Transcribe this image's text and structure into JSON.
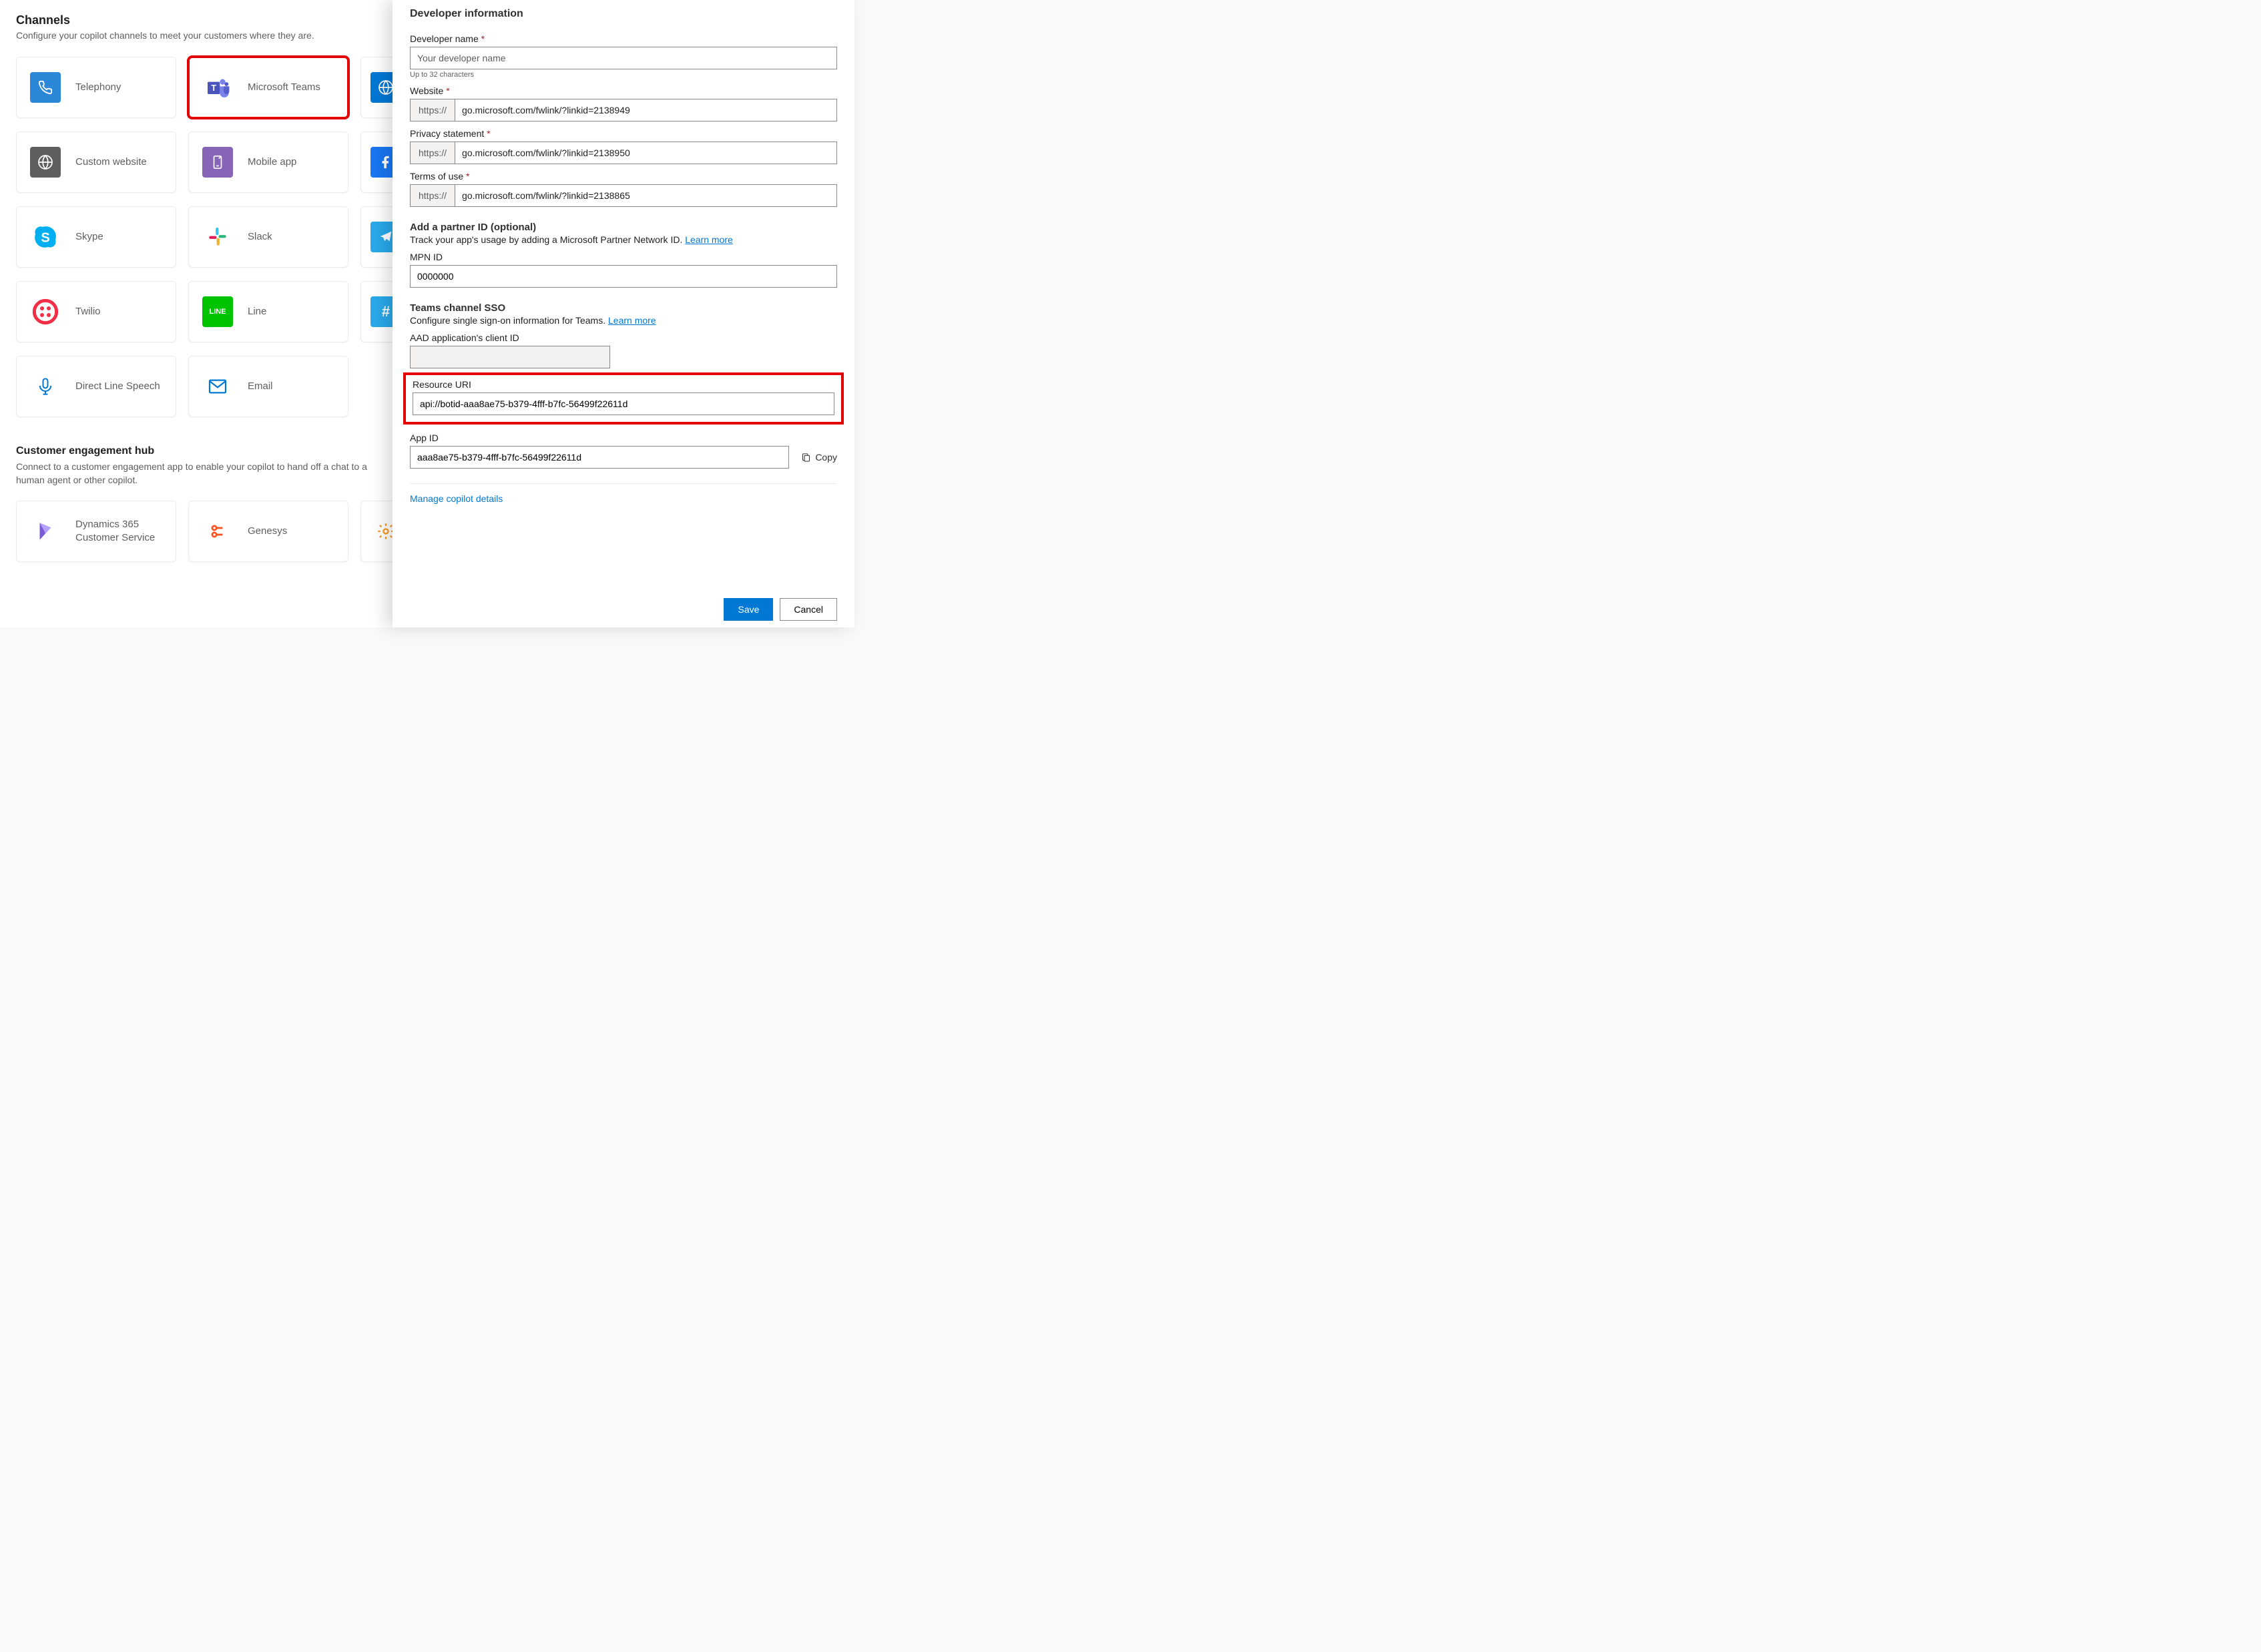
{
  "channels": {
    "title": "Channels",
    "subtitle": "Configure your copilot channels to meet your customers where they are.",
    "items": [
      {
        "id": "telephony",
        "label": "Telephony"
      },
      {
        "id": "teams",
        "label": "Microsoft Teams"
      },
      {
        "id": "demo-web",
        "label": ""
      },
      {
        "id": "custom-web",
        "label": "Custom website"
      },
      {
        "id": "mobile",
        "label": "Mobile app"
      },
      {
        "id": "facebook",
        "label": ""
      },
      {
        "id": "skype",
        "label": "Skype"
      },
      {
        "id": "slack",
        "label": "Slack"
      },
      {
        "id": "telegram",
        "label": ""
      },
      {
        "id": "twilio",
        "label": "Twilio"
      },
      {
        "id": "line",
        "label": "Line"
      },
      {
        "id": "groupme",
        "label": ""
      },
      {
        "id": "dls",
        "label": "Direct Line Speech"
      },
      {
        "id": "email",
        "label": "Email"
      }
    ]
  },
  "hub": {
    "title": "Customer engagement hub",
    "subtitle": "Connect to a customer engagement app to enable your copilot to hand off a chat to a human agent or other copilot.",
    "items": [
      {
        "id": "d365",
        "label": "Dynamics 365 Customer Service"
      },
      {
        "id": "genesys",
        "label": "Genesys"
      },
      {
        "id": "salesforce",
        "label": ""
      }
    ]
  },
  "panel": {
    "dev_info_heading": "Developer information",
    "dev_name_label": "Developer name",
    "dev_name_placeholder": "Your developer name",
    "dev_name_hint": "Up to 32 characters",
    "website_label": "Website",
    "https_prefix": "https://",
    "website_value": "go.microsoft.com/fwlink/?linkid=2138949",
    "privacy_label": "Privacy statement",
    "privacy_value": "go.microsoft.com/fwlink/?linkid=2138950",
    "terms_label": "Terms of use",
    "terms_value": "go.microsoft.com/fwlink/?linkid=2138865",
    "partner_heading": "Add a partner ID (optional)",
    "partner_desc": "Track your app's usage by adding a Microsoft Partner Network ID. ",
    "partner_learn": "Learn more",
    "mpn_label": "MPN ID",
    "mpn_value": "0000000",
    "sso_heading": "Teams channel SSO",
    "sso_desc": "Configure single sign-on information for Teams. ",
    "sso_learn": "Learn more",
    "aad_label": "AAD application's client ID",
    "aad_value": "",
    "uri_label": "Resource URI",
    "uri_value": "api://botid-aaa8ae75-b379-4fff-b7fc-56499f22611d",
    "appid_label": "App ID",
    "appid_value": "aaa8ae75-b379-4fff-b7fc-56499f22611d",
    "copy_label": "Copy",
    "manage_link": "Manage copilot details",
    "save_label": "Save",
    "cancel_label": "Cancel"
  }
}
